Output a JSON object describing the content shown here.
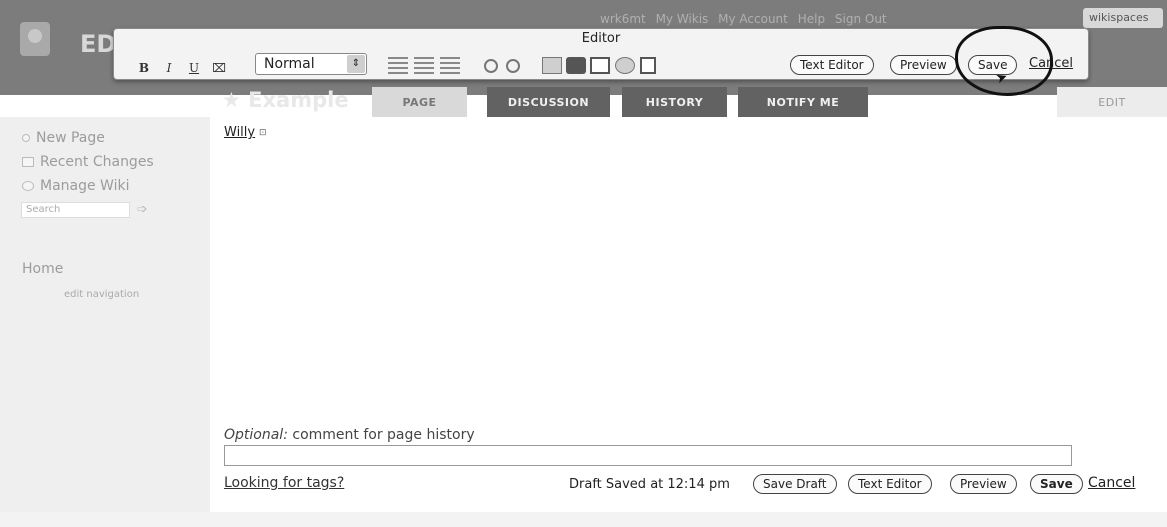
{
  "header": {
    "wiki_short": "ED",
    "user_links": [
      "wrk6mt",
      "My Wikis",
      "My Account",
      "Help",
      "Sign Out"
    ],
    "badge": "wikispaces"
  },
  "editor": {
    "title": "Editor",
    "format_buttons": [
      "B",
      "I",
      "U"
    ],
    "paragraph_style": "Normal",
    "text_editor_label": "Text Editor",
    "preview_label": "Preview",
    "save_label": "Save",
    "cancel_label": "Cancel"
  },
  "tabs": {
    "page_title": "Example",
    "items": [
      "PAGE",
      "DISCUSSION",
      "HISTORY",
      "NOTIFY ME"
    ],
    "edit_label": "EDIT"
  },
  "sidebar": {
    "items": [
      "New Page",
      "Recent Changes",
      "Manage Wiki"
    ],
    "search_placeholder": "Search",
    "home": "Home",
    "edit_navigation": "edit navigation"
  },
  "content": {
    "body_text": "Willy",
    "comment_label_prefix": "Optional:",
    "comment_label_rest": " comment for page history",
    "tags_link": "Looking for tags?",
    "draft_status": "Draft Saved at 12:14 pm",
    "save_draft_label": "Save Draft",
    "text_editor_label": "Text Editor",
    "preview_label": "Preview",
    "save_label": "Save",
    "cancel_label": "Cancel"
  },
  "colors": {
    "header_bg": "#7c7c7c",
    "tab_bg": "#626262",
    "sidebar_bg": "#efefef",
    "annotation": "#111111"
  }
}
